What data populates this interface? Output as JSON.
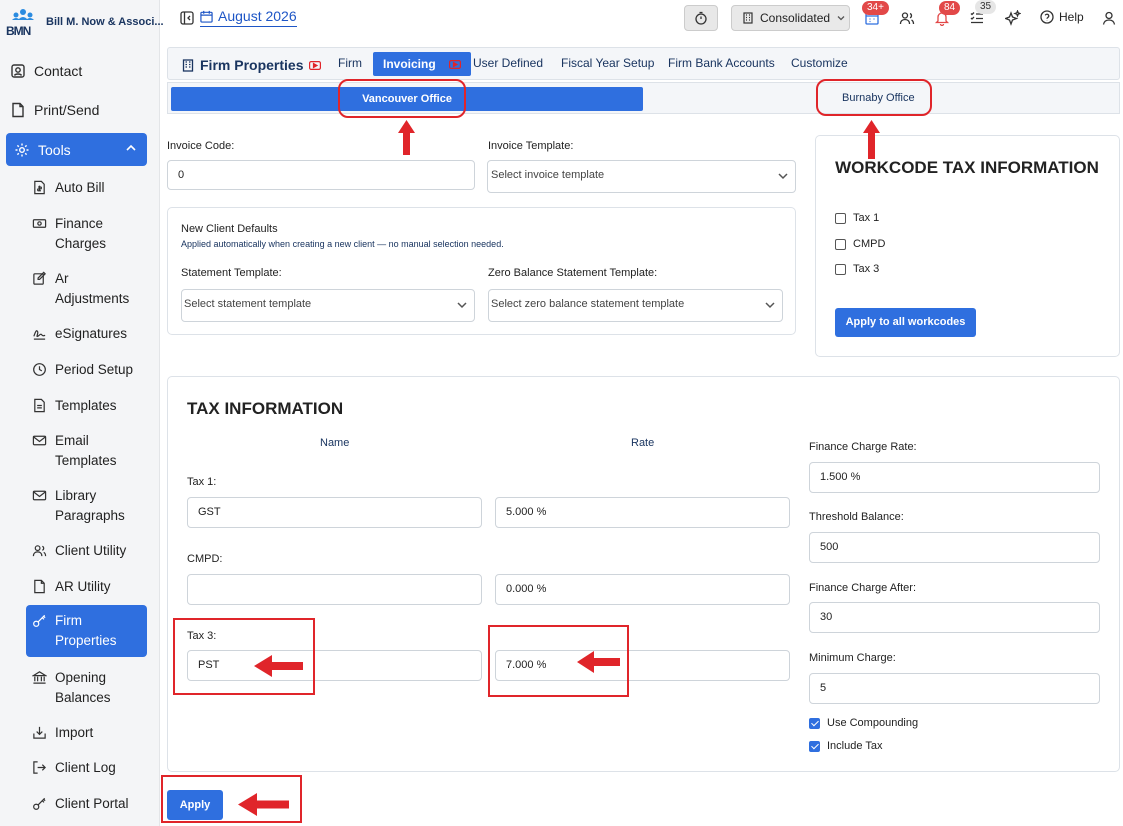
{
  "app": {
    "name": "Bill M. Now & Associ...",
    "logo_text": "BMN"
  },
  "sidebar": {
    "top_items": [
      {
        "label": "Contact"
      },
      {
        "label": "Print/Send"
      }
    ],
    "tools_label": "Tools",
    "items": [
      {
        "label": "Auto Bill"
      },
      {
        "label": "Finance Charges"
      },
      {
        "label": "Ar Adjustments"
      },
      {
        "label": "eSignatures"
      },
      {
        "label": "Period Setup"
      },
      {
        "label": "Templates"
      },
      {
        "label": "Email Templates"
      },
      {
        "label": "Library Paragraphs"
      },
      {
        "label": "Client Utility"
      },
      {
        "label": "AR Utility"
      },
      {
        "label": "Firm Properties"
      },
      {
        "label": "Opening Balances"
      },
      {
        "label": "Import"
      },
      {
        "label": "Client Log"
      },
      {
        "label": "Client Portal"
      }
    ]
  },
  "topbar": {
    "month": "August 2026",
    "consolidated": "Consolidated",
    "badges": {
      "calendar": "34+",
      "bell": "84",
      "tasks": "35"
    },
    "help": "Help"
  },
  "tabs": {
    "title": "Firm Properties",
    "items": [
      "Firm",
      "Invoicing",
      "User Defined",
      "Fiscal Year Setup",
      "Firm Bank Accounts",
      "Customize"
    ],
    "active": "Invoicing"
  },
  "offices": {
    "active": "Vancouver Office",
    "other": "Burnaby Office"
  },
  "invoice": {
    "code_label": "Invoice Code:",
    "code_value": "0",
    "template_label": "Invoice Template:",
    "template_placeholder": "Select invoice template"
  },
  "defaults": {
    "title": "New Client Defaults",
    "subtitle": "Applied automatically when creating a new client — no manual selection needed.",
    "statement_label": "Statement Template:",
    "statement_placeholder": "Select statement template",
    "zero_label": "Zero Balance Statement Template:",
    "zero_placeholder": "Select zero balance statement template"
  },
  "workcode": {
    "title": "WORKCODE TAX INFORMATION",
    "checks": [
      {
        "label": "Tax 1",
        "checked": false
      },
      {
        "label": "CMPD",
        "checked": false
      },
      {
        "label": "Tax 3",
        "checked": false
      }
    ],
    "button": "Apply to all workcodes"
  },
  "tax": {
    "title": "TAX INFORMATION",
    "name_header": "Name",
    "rate_header": "Rate",
    "rows": [
      {
        "label": "Tax 1:",
        "name": "GST",
        "rate": "5.000 %"
      },
      {
        "label": "CMPD:",
        "name": "",
        "rate": "0.000 %"
      },
      {
        "label": "Tax 3:",
        "name": "PST",
        "rate": "7.000 %"
      }
    ],
    "finance_rate_label": "Finance Charge Rate:",
    "finance_rate": "1.500 %",
    "threshold_label": "Threshold Balance:",
    "threshold": "500",
    "after_label": "Finance Charge After:",
    "after": "30",
    "min_label": "Minimum Charge:",
    "min": "5",
    "compounding": "Use Compounding",
    "include_tax": "Include Tax"
  },
  "apply": "Apply",
  "colors": {
    "primary": "#2f6fdf",
    "highlight": "#e0252a"
  }
}
